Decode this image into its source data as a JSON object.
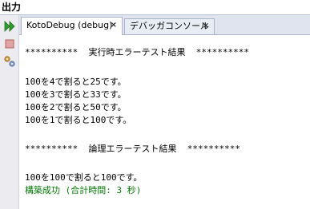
{
  "window": {
    "title": "出力"
  },
  "tabs": [
    {
      "label": "KotoDebug (debug)",
      "close": "×"
    },
    {
      "label": "デバッガコンソール",
      "close": "×"
    }
  ],
  "output": {
    "lines": [
      "**********  実行時エラーテスト結果  **********",
      "100を4で割ると25です。",
      "100を3で割ると33です。",
      "100を2で割ると50です。",
      "100を1で割ると100です。",
      "**********  論理エラーテスト結果  **********",
      "100を100で割ると100です。",
      "構築成功 (合計時間: 3 秒)"
    ]
  },
  "colors": {
    "success_text": "#007a00",
    "run_icon": "#2e9e2e",
    "stop_icon": "#d07070"
  },
  "toolbar": {
    "icons": [
      "rerun-icon",
      "stop-icon",
      "settings-icon"
    ]
  }
}
